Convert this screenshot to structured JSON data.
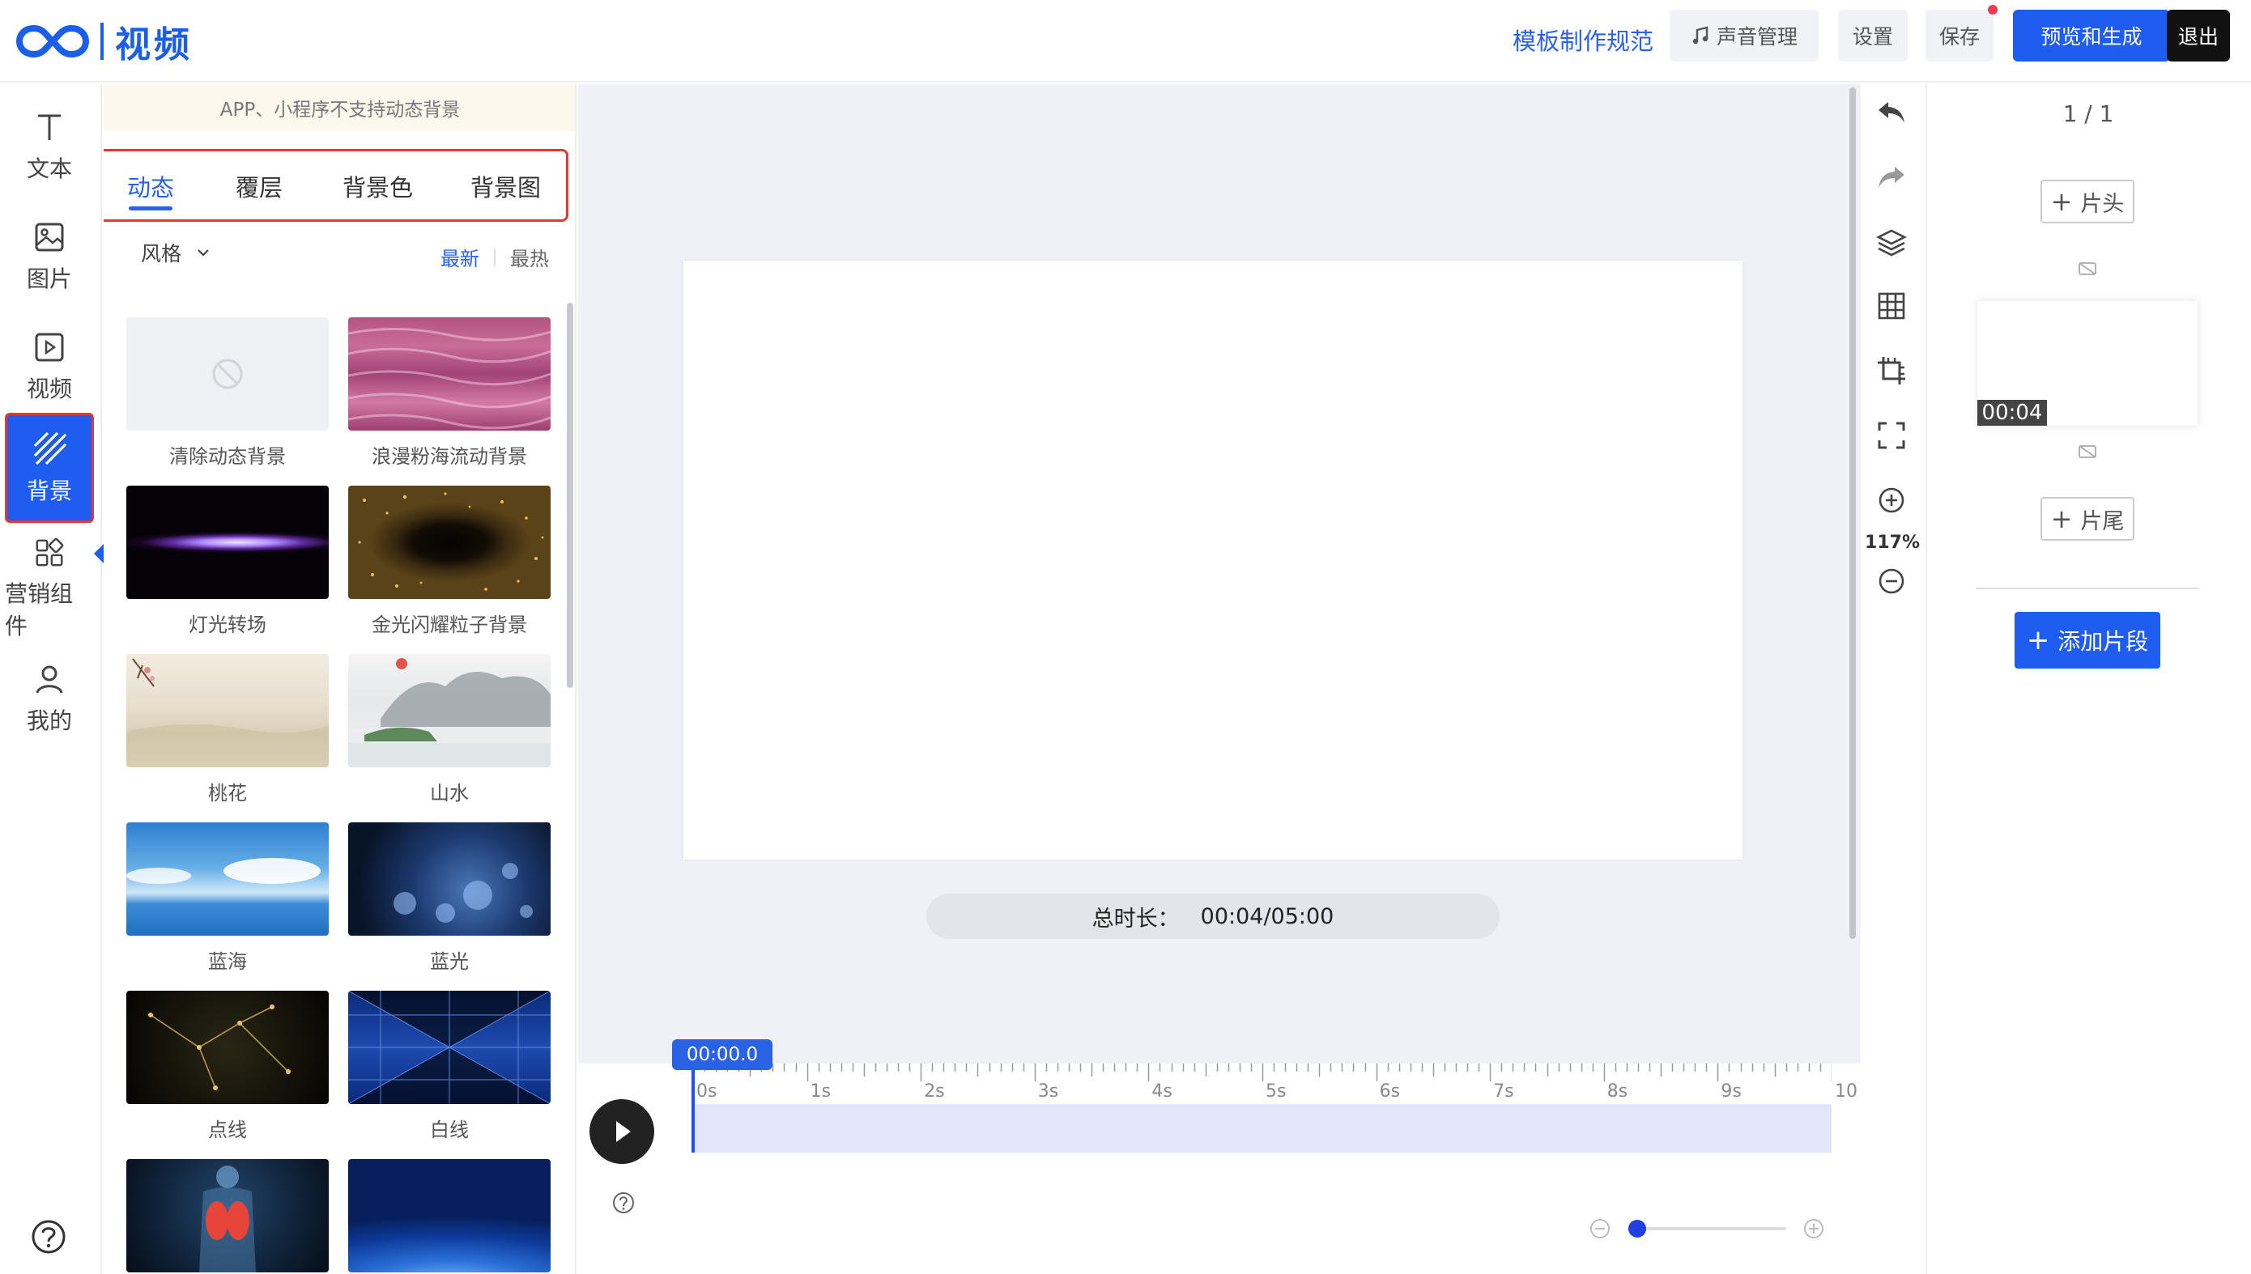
{
  "header": {
    "brand": "视频",
    "template_link": "模板制作规范",
    "sound_btn": "声音管理",
    "settings_btn": "设置",
    "save_btn": "保存",
    "preview_btn": "预览和生成",
    "exit_btn": "退出"
  },
  "leftnav": {
    "items": [
      {
        "label": "文本",
        "icon": "text-icon"
      },
      {
        "label": "图片",
        "icon": "image-icon"
      },
      {
        "label": "视频",
        "icon": "video-icon"
      },
      {
        "label": "背景",
        "icon": "background-icon",
        "active": true
      },
      {
        "label": "营销组件",
        "icon": "widgets-icon"
      },
      {
        "label": "我的",
        "icon": "user-icon"
      }
    ]
  },
  "panel": {
    "notice": "APP、小程序不支持动态背景",
    "tabs": [
      "动态",
      "覆层",
      "背景色",
      "背景图"
    ],
    "active_tab": "动态",
    "style_filter": "风格",
    "sort_selected": "最新",
    "sort_other": "最热",
    "items": [
      {
        "label": "清除动态背景"
      },
      {
        "label": "浪漫粉海流动背景"
      },
      {
        "label": "灯光转场"
      },
      {
        "label": "金光闪耀粒子背景"
      },
      {
        "label": "桃花"
      },
      {
        "label": "山水"
      },
      {
        "label": "蓝海"
      },
      {
        "label": "蓝光"
      },
      {
        "label": "点线"
      },
      {
        "label": "白线"
      }
    ]
  },
  "stage": {
    "duration_label": "总时长：",
    "duration_value": "00:04/05:00"
  },
  "timeline": {
    "playhead": "00:00.0",
    "ticks": [
      "0s",
      "1s",
      "2s",
      "3s",
      "4s",
      "5s",
      "6s",
      "7s",
      "8s",
      "9s",
      "10"
    ]
  },
  "rtools": {
    "zoom": "117%"
  },
  "rpanel": {
    "page_count": "1 / 1",
    "intro_btn": "片头",
    "outro_btn": "片尾",
    "clip_time": "00:04",
    "add_segment": "添加片段"
  },
  "colors": {
    "accent": "#1f5cf0",
    "highlight_border": "#e03a33"
  }
}
